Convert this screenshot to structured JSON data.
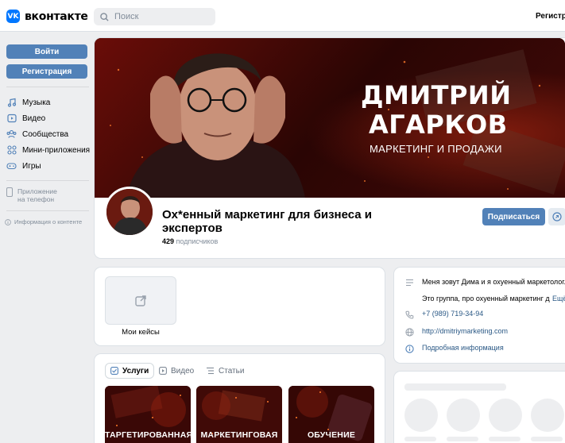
{
  "header": {
    "logo_mark": "VK",
    "logo_text": "вконтакте",
    "search_placeholder": "Поиск",
    "register_label": "Регистра"
  },
  "sidebar": {
    "login_label": "Войти",
    "register_label": "Регистрация",
    "items": [
      {
        "label": "Музыка",
        "icon": "music-icon"
      },
      {
        "label": "Видео",
        "icon": "video-icon"
      },
      {
        "label": "Сообщества",
        "icon": "communities-icon"
      },
      {
        "label": "Мини-приложения",
        "icon": "mini-apps-icon"
      },
      {
        "label": "Игры",
        "icon": "games-icon"
      }
    ],
    "app_line1": "Приложение",
    "app_line2": "на телефон",
    "info_link": "Информация о контенте"
  },
  "cover": {
    "title_line1": "ДМИТРИЙ",
    "title_line2": "АГАРКОВ",
    "subtitle": "МАРКЕТИНГ И ПРОДАЖИ"
  },
  "group": {
    "title": "Ох*енный маркетинг для бизнеса и экспертов",
    "subscriber_count": "429",
    "subscriber_label": "подписчиков",
    "subscribe_label": "Подписаться"
  },
  "cases": {
    "label": "Мои кейсы"
  },
  "tabs": [
    {
      "label": "Услуги",
      "active": true
    },
    {
      "label": "Видео",
      "active": false
    },
    {
      "label": "Статьи",
      "active": false
    }
  ],
  "services": [
    {
      "label": "ТАРГЕТИРОВАННАЯ"
    },
    {
      "label": "МАРКЕТИНГОВАЯ"
    },
    {
      "label": "ОБУЧЕНИЕ"
    }
  ],
  "info": {
    "description": "Меня зовут Дима и я охуенный маркетолог.",
    "description2": "Это группа, про охуенный маркетинг д",
    "more_label": "Ещё",
    "phone": "+7 (989) 719-34-94",
    "website": "http://dmitriymarketing.com",
    "details": "Подробная информация"
  },
  "colors": {
    "accent": "#5181b8",
    "link": "#2a5885",
    "background": "#edeef0"
  }
}
